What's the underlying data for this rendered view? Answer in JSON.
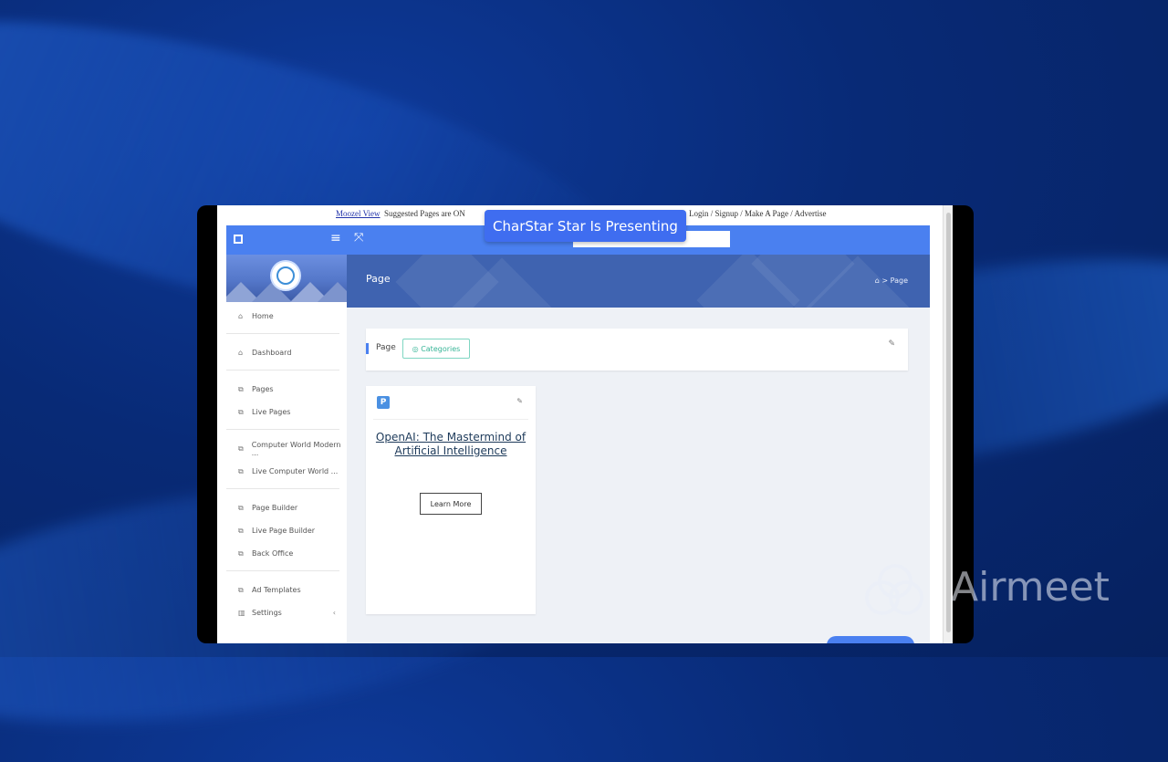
{
  "browser_bar": {
    "link_text": "Moozel View",
    "suggested": "Suggested Pages are ON",
    "right_links": "Login / Signup / Make A Page / Advertise"
  },
  "presenter_badge": "CharStar Star Is Presenting",
  "sidebar": {
    "items": [
      {
        "label": "Home",
        "icon": "home-icon"
      },
      {
        "label": "Dashboard",
        "icon": "home-icon"
      },
      {
        "label": "Pages",
        "icon": "external-link-icon"
      },
      {
        "label": "Live Pages",
        "icon": "external-link-icon"
      },
      {
        "label": "Computer World Modern ...",
        "icon": "external-link-icon"
      },
      {
        "label": "Live Computer World ...",
        "icon": "external-link-icon"
      },
      {
        "label": "Page Builder",
        "icon": "external-link-icon"
      },
      {
        "label": "Live Page Builder",
        "icon": "external-link-icon"
      },
      {
        "label": "Back Office",
        "icon": "external-link-icon"
      },
      {
        "label": "Ad Templates",
        "icon": "external-link-icon"
      },
      {
        "label": "Settings",
        "icon": "chart-icon"
      }
    ]
  },
  "banner": {
    "title": "Page",
    "breadcrumb": "⌂ > Page"
  },
  "toolbar": {
    "label": "Page",
    "chip": "◎ Categories"
  },
  "page_card": {
    "badge": "P",
    "title": "OpenAI: The Mastermind of Artificial Intelligence",
    "button": "Learn More"
  },
  "watermark": "Airmeet"
}
